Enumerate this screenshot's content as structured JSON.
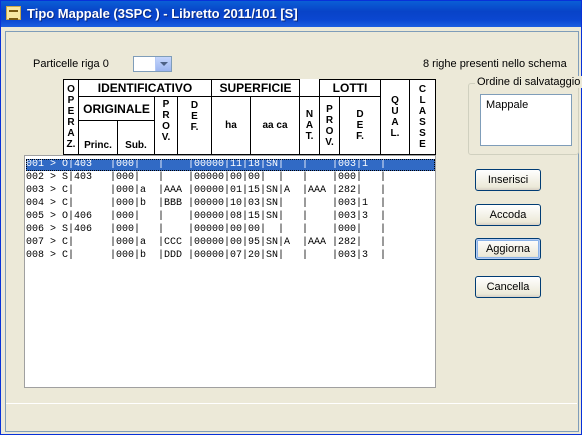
{
  "window": {
    "title": "Tipo Mappale (3SPC ) - Libretto 2011/101 [S]"
  },
  "particelle": {
    "label": "Particelle riga 0",
    "value": ""
  },
  "righe_presenti": "8 righe presenti nello schema",
  "ordine": {
    "caption": "Ordine di salvataggio",
    "items": [
      "Mappale"
    ]
  },
  "header": {
    "operaz": "O\nP\nE\nR\nA\nZ.",
    "identificativo": "IDENTIFICATIVO",
    "originale": "ORIGINALE",
    "princ": "Princ.",
    "sub": "Sub.",
    "prov": "P\nR\nO\nV.",
    "def": "D\nE\nF.",
    "superficie": "SUPERFICIE",
    "ha": "ha",
    "aa_ca": "aa ca",
    "nat": "N\nA\nT.",
    "lotti": "LOTTI",
    "lotti_prov": "P\nR\nO\nV.",
    "lotti_def": "D\nE\nF.",
    "qual": "Q\nU\nA\nL.",
    "classe": "C\nL\nA\nS\nS\nE"
  },
  "rows": [
    "001 > O|403   |000|   |    |00000|11|18|SN|   |    |003|1  |",
    "002 > S|403   |000|   |    |00000|00|00|  |   |    |000|   |",
    "003 > C|      |000|a  |AAA |00000|01|15|SN|A  |AAA |282|   |",
    "004 > C|      |000|b  |BBB |00000|10|03|SN|   |    |003|1  |",
    "005 > O|406   |000|   |    |00000|08|15|SN|   |    |003|3  |",
    "006 > S|406   |000|   |    |00000|00|00|  |   |    |000|   |",
    "007 > C|      |000|a  |CCC |00000|00|95|SN|A  |AAA |282|   |",
    "008 > C|      |000|b  |DDD |00000|07|20|SN|   |    |003|3  |"
  ],
  "selected_row": 0,
  "buttons": {
    "inserisci": "Inserisci",
    "accoda": "Accoda",
    "aggiorna": "Aggiorna",
    "cancella": "Cancella"
  }
}
